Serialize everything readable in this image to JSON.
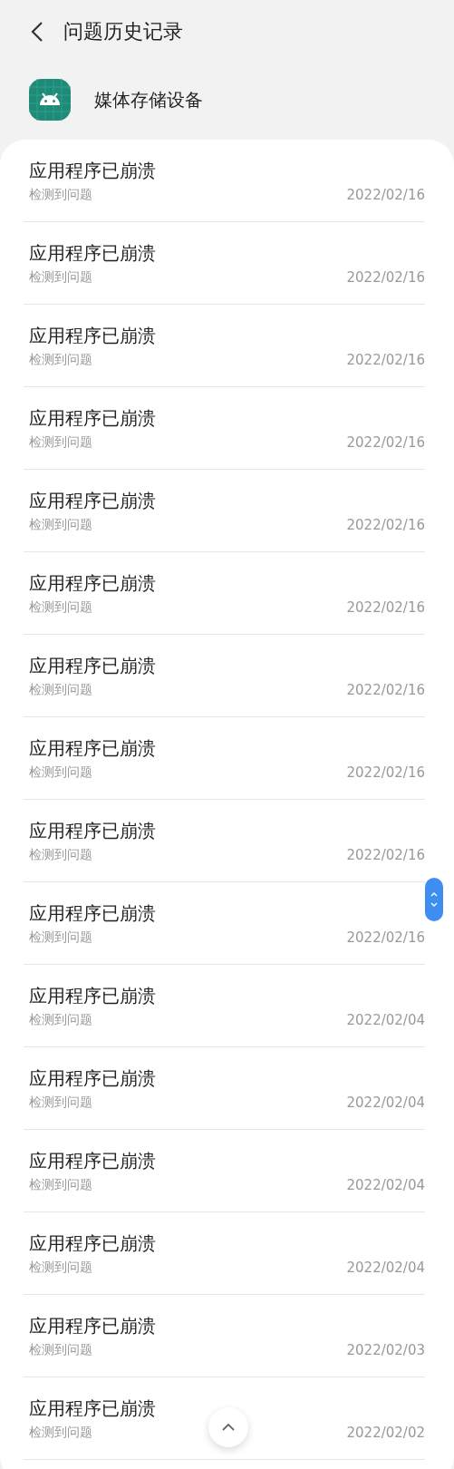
{
  "header": {
    "title": "问题历史记录"
  },
  "app": {
    "name": "媒体存储设备"
  },
  "problems": [
    {
      "title": "应用程序已崩溃",
      "subtitle": "检测到问题",
      "date": "2022/02/16"
    },
    {
      "title": "应用程序已崩溃",
      "subtitle": "检测到问题",
      "date": "2022/02/16"
    },
    {
      "title": "应用程序已崩溃",
      "subtitle": "检测到问题",
      "date": "2022/02/16"
    },
    {
      "title": "应用程序已崩溃",
      "subtitle": "检测到问题",
      "date": "2022/02/16"
    },
    {
      "title": "应用程序已崩溃",
      "subtitle": "检测到问题",
      "date": "2022/02/16"
    },
    {
      "title": "应用程序已崩溃",
      "subtitle": "检测到问题",
      "date": "2022/02/16"
    },
    {
      "title": "应用程序已崩溃",
      "subtitle": "检测到问题",
      "date": "2022/02/16"
    },
    {
      "title": "应用程序已崩溃",
      "subtitle": "检测到问题",
      "date": "2022/02/16"
    },
    {
      "title": "应用程序已崩溃",
      "subtitle": "检测到问题",
      "date": "2022/02/16"
    },
    {
      "title": "应用程序已崩溃",
      "subtitle": "检测到问题",
      "date": "2022/02/16"
    },
    {
      "title": "应用程序已崩溃",
      "subtitle": "检测到问题",
      "date": "2022/02/04"
    },
    {
      "title": "应用程序已崩溃",
      "subtitle": "检测到问题",
      "date": "2022/02/04"
    },
    {
      "title": "应用程序已崩溃",
      "subtitle": "检测到问题",
      "date": "2022/02/04"
    },
    {
      "title": "应用程序已崩溃",
      "subtitle": "检测到问题",
      "date": "2022/02/04"
    },
    {
      "title": "应用程序已崩溃",
      "subtitle": "检测到问题",
      "date": "2022/02/03"
    },
    {
      "title": "应用程序已崩溃",
      "subtitle": "检测到问题",
      "date": "2022/02/02"
    }
  ]
}
